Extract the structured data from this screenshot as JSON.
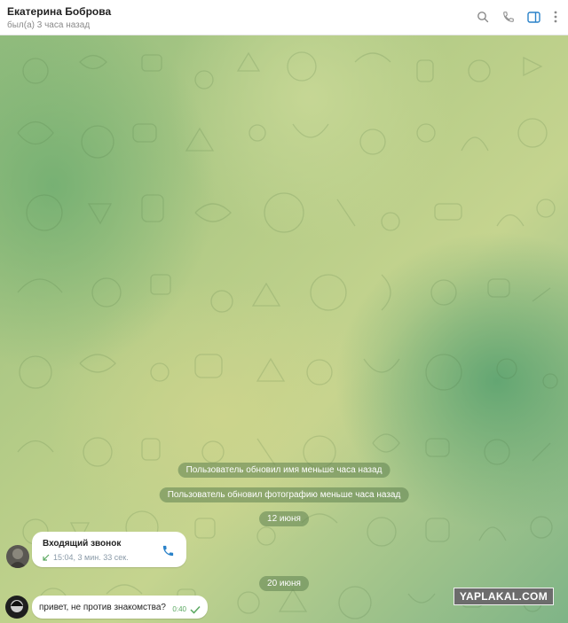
{
  "header": {
    "name": "Екатерина Боброва",
    "status": "был(а) 3 часа назад",
    "icons": [
      "search-icon",
      "phone-icon",
      "sidebar-icon",
      "more-icon"
    ],
    "accent": "#2a82c9"
  },
  "chat": {
    "service_messages": [
      "Пользователь обновил имя меньше часа назад",
      "Пользователь обновил фотографию меньше часа назад"
    ],
    "date_1": "12 июня",
    "call": {
      "title": "Входящий звонок",
      "meta": "15:04, 3 мин. 33 сек."
    },
    "date_2": "20 июня",
    "message": {
      "text": "привет, не против знакомства?",
      "time": "0:40"
    }
  },
  "watermark": "YAPLAKAL.COM"
}
